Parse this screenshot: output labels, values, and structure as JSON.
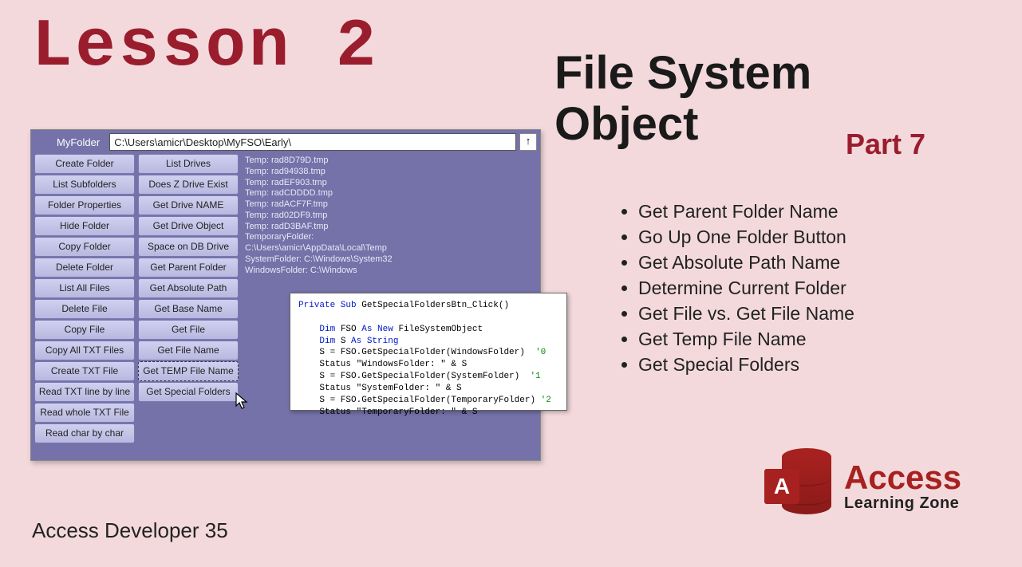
{
  "lesson_title": "Lesson 2",
  "heading": {
    "line1": "File System",
    "line2": "Object"
  },
  "part_label": "Part 7",
  "topics": [
    "Get Parent Folder Name",
    "Go Up One Folder Button",
    "Get Absolute Path Name",
    "Determine Current Folder",
    "Get File vs. Get File Name",
    "Get Temp File Name",
    "Get Special Folders"
  ],
  "footer": "Access Developer 35",
  "form": {
    "label": "MyFolder",
    "path": "C:\\Users\\amicr\\Desktop\\MyFSO\\Early\\",
    "up_symbol": "↑",
    "col1": [
      "Create Folder",
      "List Subfolders",
      "Folder Properties",
      "Hide Folder",
      "Copy Folder",
      "Delete Folder",
      "List All Files",
      "Delete File",
      "Copy File",
      "Copy All TXT Files",
      "Create TXT File",
      "Read TXT line by line",
      "Read whole TXT File",
      "Read char by char"
    ],
    "col2": [
      "List Drives",
      "Does Z Drive Exist",
      "Get Drive NAME",
      "Get Drive Object",
      "Space on DB Drive",
      "Get Parent Folder",
      "Get Absolute Path",
      "Get Base Name",
      "Get File",
      "Get File Name",
      "Get TEMP File Name",
      "Get Special Folders"
    ],
    "output": [
      "Temp: rad8D79D.tmp",
      "Temp: rad94938.tmp",
      "Temp: radEF903.tmp",
      "Temp: radCDDDD.tmp",
      "Temp: radACF7F.tmp",
      "Temp: rad02DF9.tmp",
      "Temp: radD3BAF.tmp",
      "TemporaryFolder:",
      "C:\\Users\\amicr\\AppData\\Local\\Temp",
      "SystemFolder: C:\\Windows\\System32",
      "WindowsFolder: C:\\Windows"
    ]
  },
  "code": {
    "l1a": "Private Sub",
    "l1b": " GetSpecialFoldersBtn_Click()",
    "l2a": "    Dim",
    "l2b": " FSO ",
    "l2c": "As New",
    "l2d": " FileSystemObject",
    "l3a": "    Dim",
    "l3b": " S ",
    "l3c": "As String",
    "l4": "    S = FSO.GetSpecialFolder(WindowsFolder)  ",
    "c4": "'0",
    "l5": "    Status \"WindowsFolder: \" & S",
    "l6": "    S = FSO.GetSpecialFolder(SystemFolder)  ",
    "c6": "'1",
    "l7": "    Status \"SystemFolder: \" & S",
    "l8": "    S = FSO.GetSpecialFolder(TemporaryFolder) ",
    "c8": "'2",
    "l9": "    Status \"TemporaryFolder: \" & S"
  },
  "logo": {
    "letter": "A",
    "line1": "Access",
    "line2": "Learning Zone"
  }
}
